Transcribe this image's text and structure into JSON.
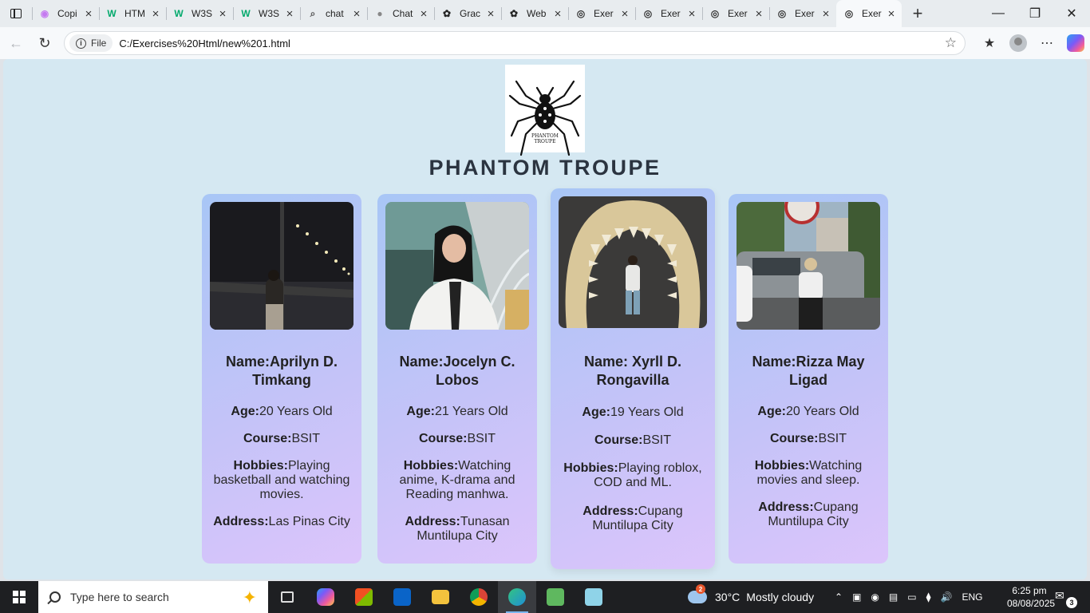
{
  "browser": {
    "tabs": [
      {
        "title": "Copi",
        "icon": "copilot-icon",
        "color": "#c57af0"
      },
      {
        "title": "HTM",
        "icon": "w3schools-icon",
        "color": "#04aa6d"
      },
      {
        "title": "W3S",
        "icon": "w3schools-icon",
        "color": "#04aa6d"
      },
      {
        "title": "W3S",
        "icon": "w3schools-icon",
        "color": "#04aa6d"
      },
      {
        "title": "chat",
        "icon": "search-icon",
        "color": "#555555"
      },
      {
        "title": "Chat",
        "icon": "chatgpt-icon",
        "color": "#888888"
      },
      {
        "title": "Grac",
        "icon": "openai-icon",
        "color": "#222222"
      },
      {
        "title": "Web",
        "icon": "openai-icon",
        "color": "#222222"
      },
      {
        "title": "Exer",
        "icon": "globe-icon",
        "color": "#333333"
      },
      {
        "title": "Exer",
        "icon": "globe-icon",
        "color": "#333333"
      },
      {
        "title": "Exer",
        "icon": "globe-icon",
        "color": "#333333"
      },
      {
        "title": "Exer",
        "icon": "globe-icon",
        "color": "#333333"
      },
      {
        "title": "Exer",
        "icon": "globe-icon",
        "color": "#333333"
      }
    ],
    "active_tab_index": 12,
    "file_chip": "File",
    "url": "C:/Exercises%20Html/new%201.html"
  },
  "page": {
    "logo_caption_line1": "PHANTOM",
    "logo_caption_line2": "TROUPE",
    "title": "PHANTOM TROUPE",
    "members": [
      {
        "name_label": "Name:",
        "name": "Aprilyn D. Timkang",
        "age_label": "Age:",
        "age": "20 Years Old",
        "course_label": "Course:",
        "course": "BSIT",
        "hobbies_label": "Hobbies:",
        "hobbies": "Playing basketball and watching movies.",
        "address_label": "Address:",
        "address": "Las Pinas City"
      },
      {
        "name_label": "Name:",
        "name": "Jocelyn C. Lobos",
        "age_label": "Age:",
        "age": "21 Years Old",
        "course_label": "Course:",
        "course": "BSIT",
        "hobbies_label": "Hobbies:",
        "hobbies": "Watching anime, K-drama and Reading manhwa.",
        "address_label": "Address:",
        "address": "Tunasan Muntilupa City"
      },
      {
        "name_label": "Name:",
        "name": " Xyrll D. Rongavilla",
        "age_label": "Age:",
        "age": "19 Years Old",
        "course_label": "Course:",
        "course": "BSIT",
        "hobbies_label": "Hobbies:",
        "hobbies": "Playing roblox, COD and ML.",
        "address_label": "Address:",
        "address": "Cupang Muntilupa City"
      },
      {
        "name_label": "Name:",
        "name": "Rizza May Ligad",
        "age_label": "Age:",
        "age": "20 Years Old",
        "course_label": "Course:",
        "course": "BSIT",
        "hobbies_label": "Hobbies:",
        "hobbies": "Watching movies and sleep.",
        "address_label": "Address:",
        "address": "Cupang Muntilupa City"
      }
    ]
  },
  "taskbar": {
    "search_placeholder": "Type here to search",
    "weather_badge": "2",
    "weather_temp": "30°C",
    "weather_text": "Mostly cloudy",
    "language": "ENG",
    "time": "6:25 pm",
    "date": "08/08/2025",
    "notification_count": "3"
  }
}
